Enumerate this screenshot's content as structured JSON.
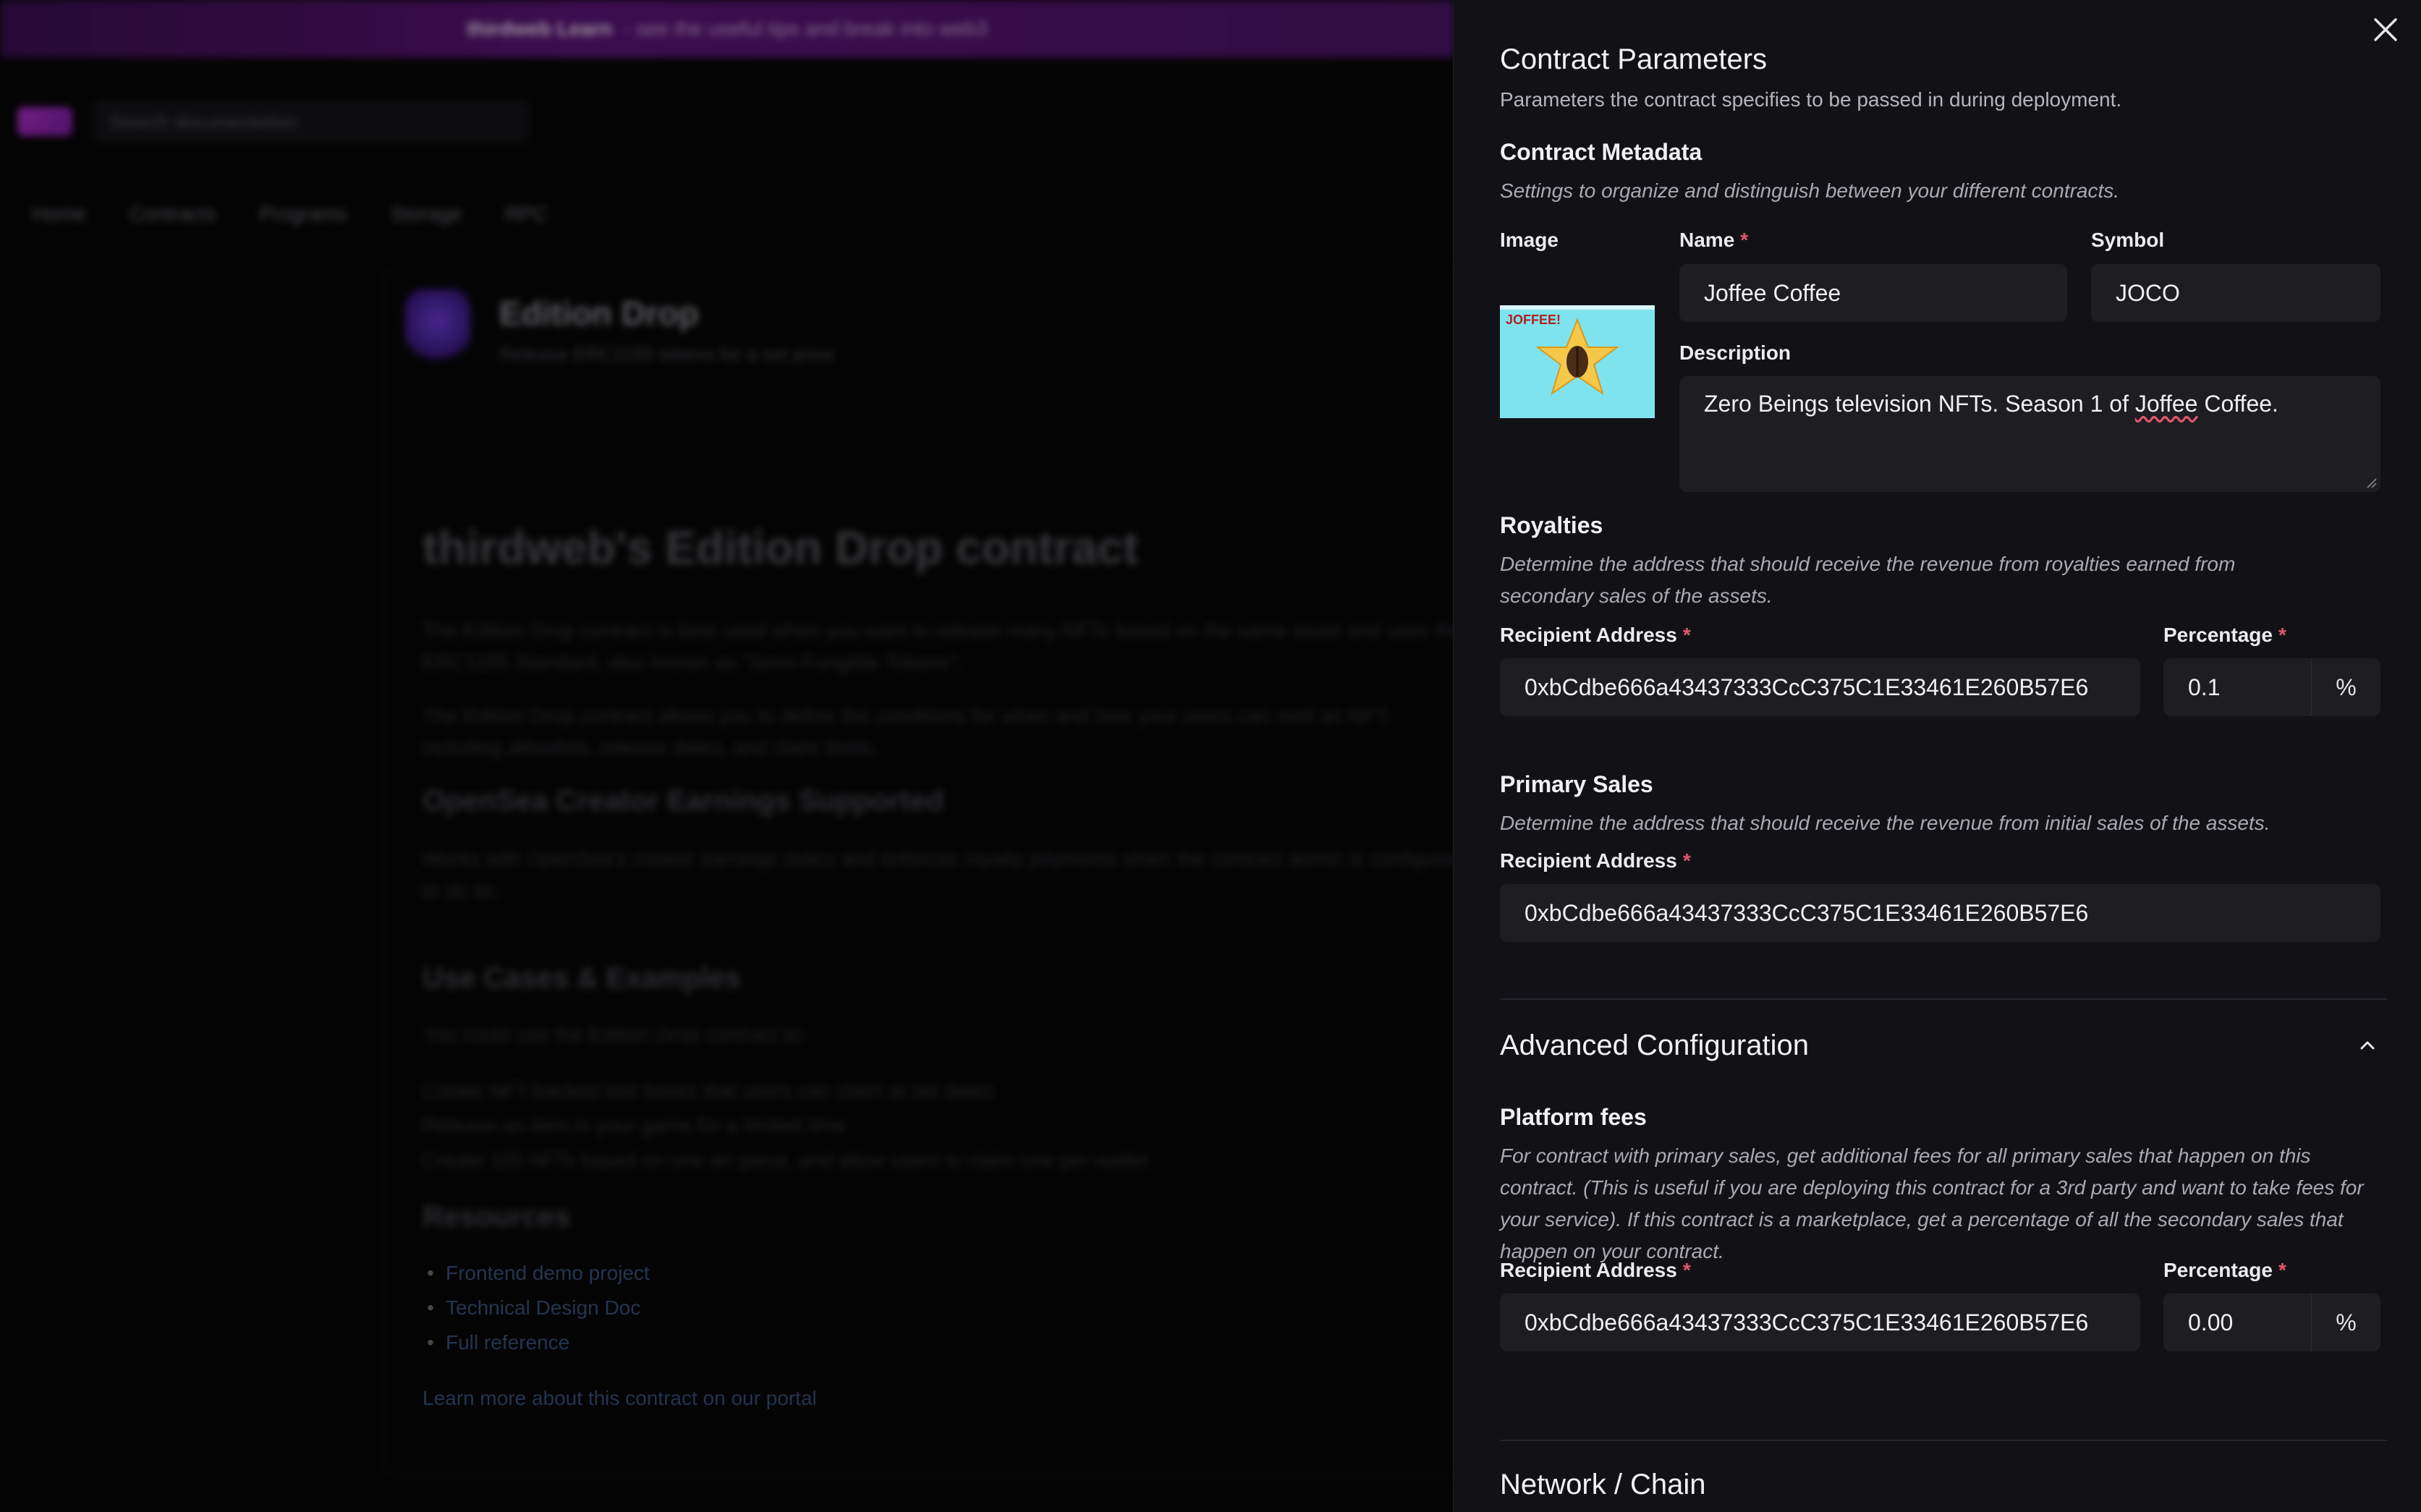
{
  "background": {
    "banner_bold": "thirdweb Learn",
    "banner_text": "- see the useful tips and break into web3",
    "search_placeholder": "Search documentation",
    "nav": [
      "Home",
      "Contracts",
      "Programs",
      "Storage",
      "RPC"
    ],
    "contract_title": "Edition Drop",
    "contract_subtitle": "Release ERC1155 tokens for a set price",
    "heading": "thirdweb's Edition Drop contract",
    "para1": "The Edition Drop contract is best used when you want to release many NFTs based on the same asset and uses the ERC1155 Standard, also known as \"Semi-Fungible Tokens\".",
    "para2": "The Edition Drop contract allows you to define the conditions for when and how your users can mint an NFT, including allowlists, release dates, and claim limits.",
    "h2_opensea": "OpenSea Creator Earnings Supported",
    "para3": "Works with OpenSea's creator earnings policy and enforces royalty payments when the contract admin is configured to do so.",
    "h2_usecases": "Use Cases & Examples",
    "para4": "You could use the Edition Drop contract to:",
    "bullets": [
      "Create NFT-backed loot boxes that users can claim at set dates",
      "Release an item in your game for a limited time",
      "Create 100 NFTs based on one art piece, and allow users to claim one per wallet"
    ],
    "h2_resources": "Resources",
    "links": [
      "Frontend demo project",
      "Technical Design Doc",
      "Full reference"
    ],
    "learn_more": "Learn more about this contract on our portal"
  },
  "drawer": {
    "title": "Contract Parameters",
    "subtitle": "Parameters the contract specifies to be passed in during deployment.",
    "metadata": {
      "title": "Contract Metadata",
      "desc": "Settings to organize and distinguish between your different contracts.",
      "image_label": "Image",
      "image_text": "JOFFEE!",
      "name_label": "Name",
      "name_value": "Joffee Coffee",
      "symbol_label": "Symbol",
      "symbol_value": "JOCO",
      "description_label": "Description",
      "description_before": "Zero Beings television NFTs. Season 1 of ",
      "description_word": "Joffee",
      "description_after": " Coffee."
    },
    "royalties": {
      "title": "Royalties",
      "desc": "Determine the address that should receive the revenue from royalties earned from secondary sales of the assets.",
      "recipient_label": "Recipient Address",
      "recipient_value": "0xbCdbe666a43437333CcC375C1E33461E260B57E6",
      "percentage_label": "Percentage",
      "percentage_value": "0.1",
      "suffix": "%"
    },
    "primary_sales": {
      "title": "Primary Sales",
      "desc": "Determine the address that should receive the revenue from initial sales of the assets.",
      "recipient_label": "Recipient Address",
      "recipient_value": "0xbCdbe666a43437333CcC375C1E33461E260B57E6"
    },
    "advanced": {
      "title": "Advanced Configuration",
      "platform_title": "Platform fees",
      "platform_desc": "For contract with primary sales, get additional fees for all primary sales that happen on this contract. (This is useful if you are deploying this contract for a 3rd party and want to take fees for your service). If this contract is a marketplace, get a percentage of all the secondary sales that happen on your contract.",
      "recipient_label": "Recipient Address",
      "recipient_value": "0xbCdbe666a43437333CcC375C1E33461E260B57E6",
      "percentage_label": "Percentage",
      "percentage_value": "0.00",
      "suffix": "%"
    },
    "network_title": "Network / Chain",
    "required_mark": "*"
  },
  "colors": {
    "accent_required": "#e0576e",
    "panel_bg": "#121216",
    "input_bg": "#1d1d22",
    "banner": "#5b1478"
  }
}
